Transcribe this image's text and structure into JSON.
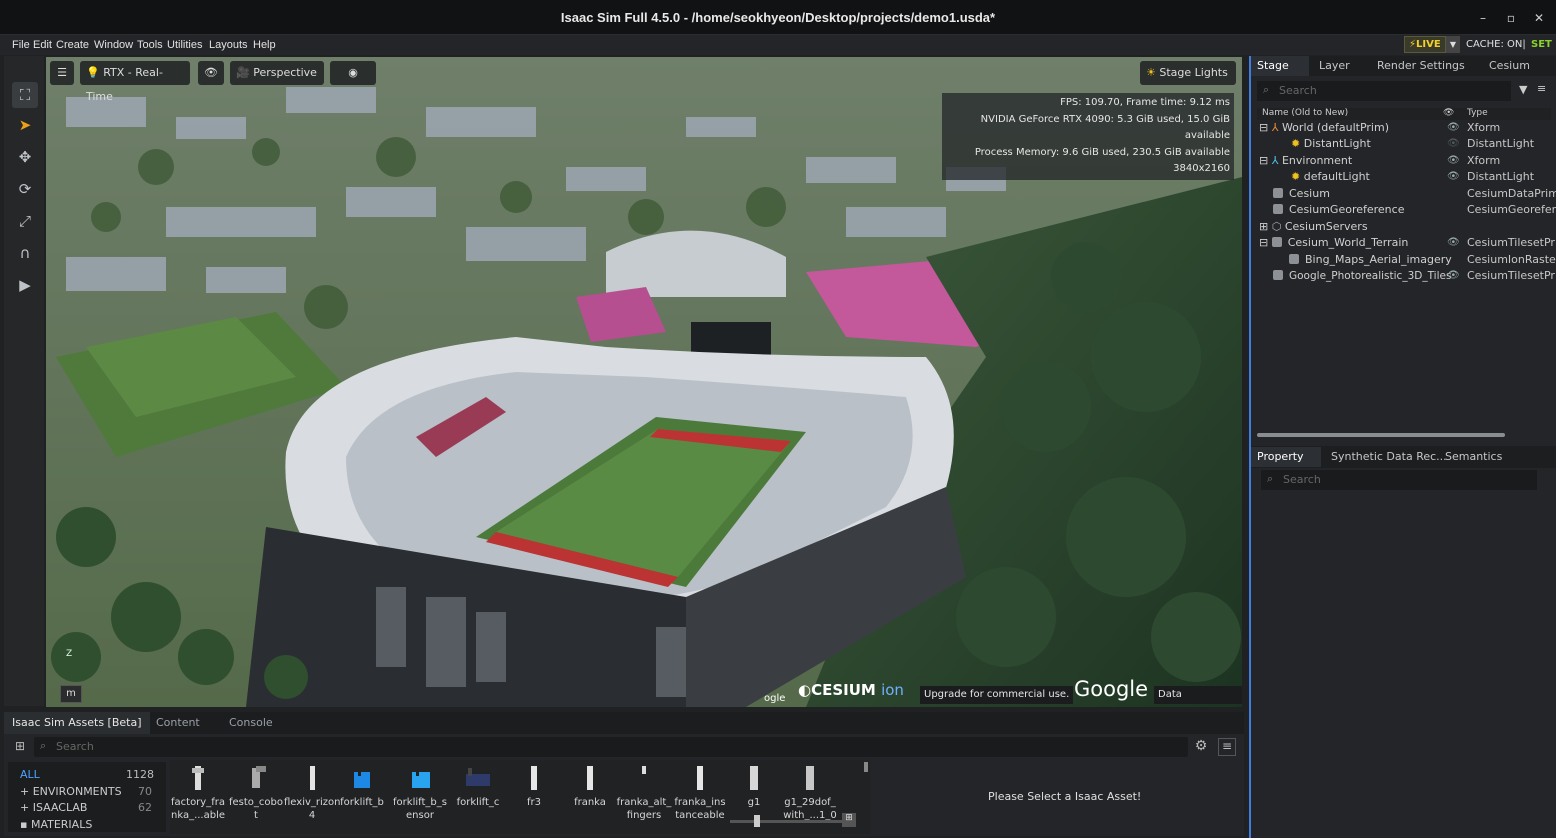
{
  "window": {
    "title": "Isaac Sim Full 4.5.0 - /home/seokhyeon/Desktop/projects/demo1.usda*"
  },
  "menu": [
    "File",
    "Edit",
    "Create",
    "Window",
    "Tools",
    "Utilities",
    "Layouts",
    "Help"
  ],
  "status": {
    "live": "LIVE",
    "cache": "CACHE: ON|",
    "set": "SET"
  },
  "viewport": {
    "renderer": "RTX - Real-Time",
    "camera": "Perspective",
    "lights": "Stage Lights",
    "stats": [
      "FPS: 109.70, Frame time: 9.12 ms",
      "NVIDIA GeForce RTX 4090: 5.3 GiB used, 15.0 GiB available",
      "Process Memory: 9.6 GiB used, 230.5 GiB available",
      "3840x2160"
    ],
    "cesium_logo": "CESIUM",
    "cesium_ion": "ion",
    "upgrade": "Upgrade for commercial use.",
    "google": "Google",
    "attribution": "Data Attribution",
    "google_small": "ogle",
    "axis_z": "Z",
    "m_button": "m",
    "colors": {
      "field": "#4f7a3c",
      "roof": "#c3589a",
      "trees": "#243f2a"
    }
  },
  "stage": {
    "tabs": [
      "Stage",
      "Layer",
      "Render Settings",
      "Cesium"
    ],
    "search_placeholder": "Search",
    "col_name": "Name (Old to New)",
    "col_type": "Type",
    "rows": [
      {
        "name": "World (defaultPrim)",
        "type": "Xform"
      },
      {
        "name": "DistantLight",
        "type": "DistantLight"
      },
      {
        "name": "Environment",
        "type": "Xform"
      },
      {
        "name": "defaultLight",
        "type": "DistantLight"
      },
      {
        "name": "Cesium",
        "type": "CesiumDataPrim"
      },
      {
        "name": "CesiumGeoreference",
        "type": "CesiumGeorefer"
      },
      {
        "name": "CesiumServers",
        "type": ""
      },
      {
        "name": "Cesium_World_Terrain",
        "type": "CesiumTilesetPr"
      },
      {
        "name": "Bing_Maps_Aerial_imagery",
        "type": "CesiumIonRaste"
      },
      {
        "name": "Google_Photorealistic_3D_Tiles",
        "type": "CesiumTilesetPr"
      }
    ]
  },
  "property": {
    "tabs": [
      "Property",
      "Synthetic Data Rec...",
      "Semantics Schema..."
    ],
    "search_placeholder": "Search"
  },
  "bottom": {
    "tabs": [
      "Isaac Sim Assets [Beta]",
      "Content",
      "Console"
    ],
    "search_placeholder": "Search",
    "categories": [
      {
        "name": "ALL",
        "count": "1128"
      },
      {
        "name": "ENVIRONMENTS",
        "count": "70"
      },
      {
        "name": "ISAACLAB",
        "count": "62"
      },
      {
        "name": "MATERIALS",
        "count": ""
      }
    ],
    "assets": [
      {
        "line1": "factory_fra",
        "line2": "nka_...able"
      },
      {
        "line1": "festo_cobo",
        "line2": "t"
      },
      {
        "line1": "flexiv_rizon",
        "line2": "4"
      },
      {
        "line1": "forklift_b",
        "line2": ""
      },
      {
        "line1": "forklift_b_s",
        "line2": "ensor"
      },
      {
        "line1": "forklift_c",
        "line2": ""
      },
      {
        "line1": "fr3",
        "line2": ""
      },
      {
        "line1": "franka",
        "line2": ""
      },
      {
        "line1": "franka_alt_",
        "line2": "fingers"
      },
      {
        "line1": "franka_ins",
        "line2": "tanceable"
      },
      {
        "line1": "g1",
        "line2": ""
      },
      {
        "line1": "g1_29dof_",
        "line2": "with_...1_0"
      }
    ],
    "message": "Please Select a Isaac Asset!"
  }
}
